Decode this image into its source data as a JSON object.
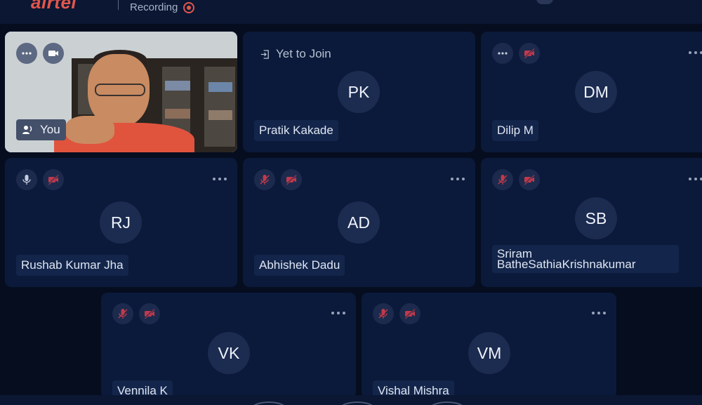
{
  "topbar": {
    "logo": "airtel",
    "recording_label": "Recording"
  },
  "self_tile": {
    "label": "You"
  },
  "tiles": [
    {
      "initials": "PK",
      "name": "Pratik Kakade",
      "status": "Yet to Join"
    },
    {
      "initials": "DM",
      "name": "Dilip M"
    },
    {
      "initials": "RJ",
      "name": "Rushab Kumar Jha"
    },
    {
      "initials": "AD",
      "name": "Abhishek Dadu"
    },
    {
      "initials": "SB",
      "name": "Sriram BatheSathiaKrishnakumar"
    },
    {
      "initials": "VK",
      "name": "Vennila K"
    },
    {
      "initials": "VM",
      "name": "Vishal Mishra"
    }
  ],
  "colors": {
    "background": "#050d1f",
    "tile": "#0b1a3a",
    "muted_red": "#c0394b",
    "accent_red": "#e2574c"
  },
  "icons": {
    "mic": "microphone-icon",
    "mic_muted": "microphone-muted-icon",
    "camera_off": "camera-off-icon",
    "camera": "camera-icon",
    "more": "more-options-icon",
    "join": "yet-to-join-icon",
    "speaker": "active-speaker-icon"
  }
}
